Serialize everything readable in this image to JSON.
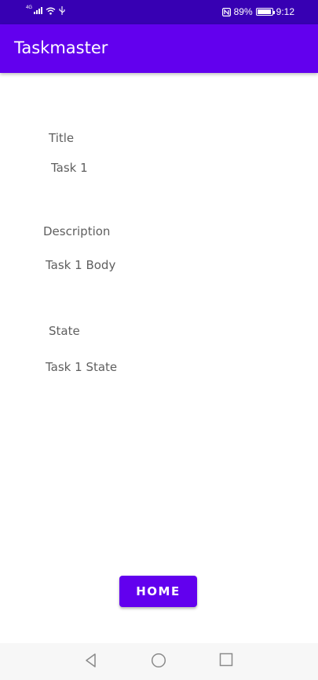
{
  "status_bar": {
    "network": "4G",
    "battery_percent": "89%",
    "time": "9:12",
    "icons": [
      "signal-icon",
      "wifi-icon",
      "usb-icon",
      "nfc-icon",
      "battery-icon"
    ]
  },
  "app_bar": {
    "title": "Taskmaster"
  },
  "task": {
    "title_label": "Title",
    "title_value": "Task 1",
    "description_label": "Description",
    "description_value": "Task 1 Body",
    "state_label": "State",
    "state_value": "Task 1 State"
  },
  "home_button": {
    "label": "HOME"
  },
  "nav_bar": {
    "icons": [
      "back-icon",
      "home-circle-icon",
      "recents-icon"
    ]
  },
  "colors": {
    "primary": "#6200ee",
    "primary_dark": "#3700b3",
    "text": "#5f5f5f"
  }
}
